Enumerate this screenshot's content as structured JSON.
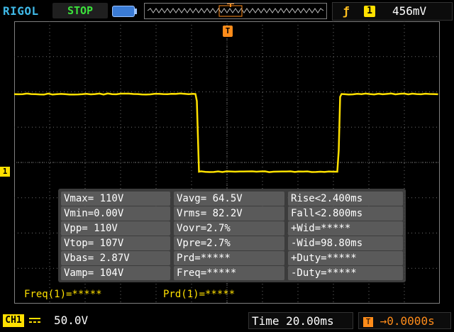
{
  "top": {
    "brand": "RIGOL",
    "run_state": "STOP",
    "trigger_edge_icon": "rising-edge-icon",
    "trigger_channel": "1",
    "trigger_level": "456mV"
  },
  "markers": {
    "trigger_position": "T",
    "channel_level": "1"
  },
  "measurements": {
    "rows": [
      {
        "c1": "Vmax= 110V",
        "c2": "Vavg= 64.5V",
        "c3": "Rise<2.400ms"
      },
      {
        "c1": "Vmin=0.00V",
        "c2": "Vrms= 82.2V",
        "c3": "Fall<2.800ms"
      },
      {
        "c1": "Vpp= 110V",
        "c2": "Vovr=2.7%",
        "c3": "+Wid=*****"
      },
      {
        "c1": "Vtop= 107V",
        "c2": "Vpre=2.7%",
        "c3": "-Wid=98.80ms"
      },
      {
        "c1": "Vbas= 2.87V",
        "c2": "Prd=*****",
        "c3": "+Duty=*****"
      },
      {
        "c1": "Vamp= 104V",
        "c2": "Freq=*****",
        "c3": "-Duty=*****"
      }
    ]
  },
  "counters": {
    "freq": "Freq(1)=*****",
    "prd": "Prd(1)=*****"
  },
  "bottom": {
    "channel_label": "CH1",
    "coupling_icon": "dc-coupling-icon",
    "vertical_scale": "50.0V",
    "timebase": "Time 20.00ms",
    "trigger_offset": "→0.0000s",
    "trigger_offset_icon": "trigger-offset-icon"
  },
  "colors": {
    "trace": "#ffe000",
    "grid": "#6e6e6e",
    "brand": "#3fb8e6",
    "stop": "#3be23b",
    "trigger": "#ff8c1a"
  },
  "waveform": {
    "high_level_v": 110,
    "low_level_v": 0,
    "falling_edge_time_div": 5.15,
    "rising_edge_time_div": 9.15
  }
}
